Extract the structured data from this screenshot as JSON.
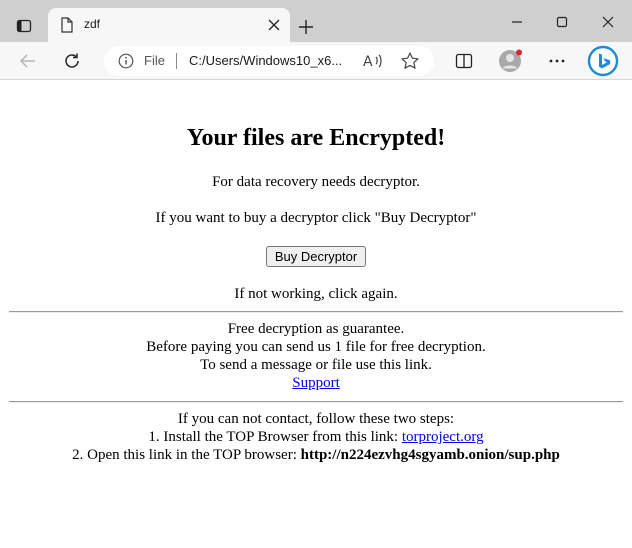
{
  "browser": {
    "tab_title": "zdf",
    "address": {
      "scheme_label": "File",
      "url": "C:/Users/Windows10_x6..."
    },
    "icons": {
      "tab_actions": "tab-actions-icon",
      "favicon": "document-icon",
      "tab_close": "close-icon",
      "new_tab": "plus-icon",
      "minimize": "minimize-icon",
      "maximize": "maximize-icon",
      "close_window": "close-icon",
      "back": "back-arrow-icon",
      "refresh": "refresh-icon",
      "site_info": "info-icon",
      "read_aloud": "read-aloud-icon",
      "favorite": "star-icon",
      "split_screen": "split-screen-icon",
      "profile": "profile-icon",
      "menu": "more-icon",
      "bing": "bing-icon"
    },
    "colors": {
      "titlebar": "#cfcfcf",
      "toolbar": "#f7f7f7",
      "profile_badge": "#e0242a",
      "bing_blue": "#1e8bd6"
    }
  },
  "note": {
    "heading": "Your files are Encrypted!",
    "line1": "For data recovery needs decryptor.",
    "line2": "If you want to buy a decryptor click \"Buy Decryptor\"",
    "buy_button": "Buy Decryptor",
    "line3": "If not working, click again.",
    "guarantee": {
      "line1": "Free decryption as guarantee.",
      "line2": "Before paying you can send us 1 file for free decryption.",
      "line3": "To send a message or file use this link.",
      "support_link": "Support"
    },
    "contact": {
      "line1": "If you can not contact, follow these two steps:",
      "step1_text": "1. Install the TOP Browser from this link: ",
      "step1_link": "torproject.org",
      "step2_text": "2. Open this link in the TOP browser: ",
      "step2_url": "http://n224ezvhg4sgyamb.onion/sup.php"
    },
    "link_color": "#0000ee"
  }
}
